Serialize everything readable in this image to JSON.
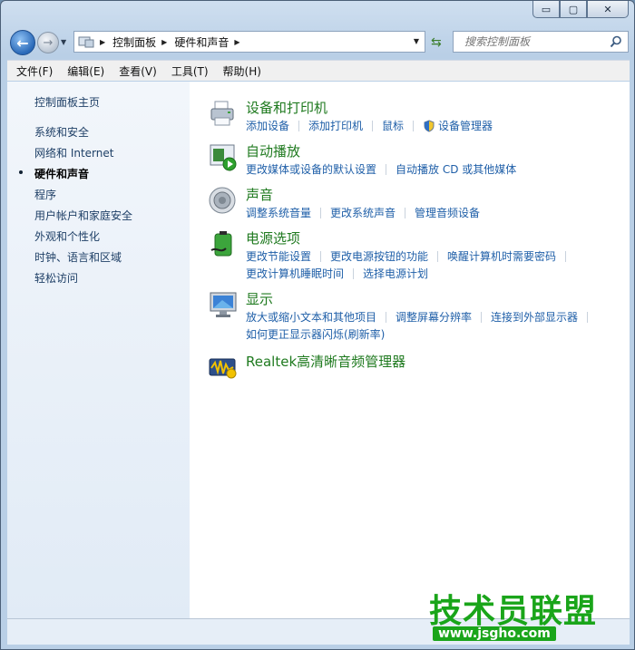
{
  "window": {
    "caption": {
      "minimize": "▭",
      "maximize": "▢",
      "close": "✕"
    }
  },
  "address_bar": {
    "crumbs": [
      "控制面板",
      "硬件和声音"
    ],
    "search_placeholder": "搜索控制面板"
  },
  "menu": [
    "文件(F)",
    "编辑(E)",
    "查看(V)",
    "工具(T)",
    "帮助(H)"
  ],
  "sidebar": {
    "home": "控制面板主页",
    "items": [
      {
        "label": "系统和安全",
        "active": false
      },
      {
        "label": "网络和 Internet",
        "active": false
      },
      {
        "label": "硬件和声音",
        "active": true
      },
      {
        "label": "程序",
        "active": false
      },
      {
        "label": "用户帐户和家庭安全",
        "active": false
      },
      {
        "label": "外观和个性化",
        "active": false
      },
      {
        "label": "时钟、语言和区域",
        "active": false
      },
      {
        "label": "轻松访问",
        "active": false
      }
    ]
  },
  "categories": [
    {
      "title": "设备和打印机",
      "icon": "printer-icon",
      "links": [
        [
          "添加设备",
          "添加打印机",
          "鼠标",
          "设备管理器"
        ]
      ]
    },
    {
      "title": "自动播放",
      "icon": "autoplay-icon",
      "links": [
        [
          "更改媒体或设备的默认设置",
          "自动播放 CD 或其他媒体"
        ]
      ]
    },
    {
      "title": "声音",
      "icon": "speaker-icon",
      "links": [
        [
          "调整系统音量",
          "更改系统声音",
          "管理音频设备"
        ]
      ]
    },
    {
      "title": "电源选项",
      "icon": "battery-icon",
      "links": [
        [
          "更改节能设置",
          "更改电源按钮的功能",
          "唤醒计算机时需要密码"
        ],
        [
          "更改计算机睡眠时间",
          "选择电源计划"
        ]
      ]
    },
    {
      "title": "显示",
      "icon": "monitor-icon",
      "links": [
        [
          "放大或缩小文本和其他项目",
          "调整屏幕分辨率",
          "连接到外部显示器"
        ],
        [
          "如何更正显示器闪烁(刷新率)"
        ]
      ]
    },
    {
      "title": "Realtek高清晰音频管理器",
      "icon": "realtek-audio-icon",
      "links": []
    }
  ],
  "watermark": {
    "text": "技术员联盟",
    "url": "www.jsgho.com"
  },
  "colors": {
    "category_title": "#1f7a1f",
    "link": "#1f5fa8",
    "sidebar_link": "#1e3f66"
  }
}
